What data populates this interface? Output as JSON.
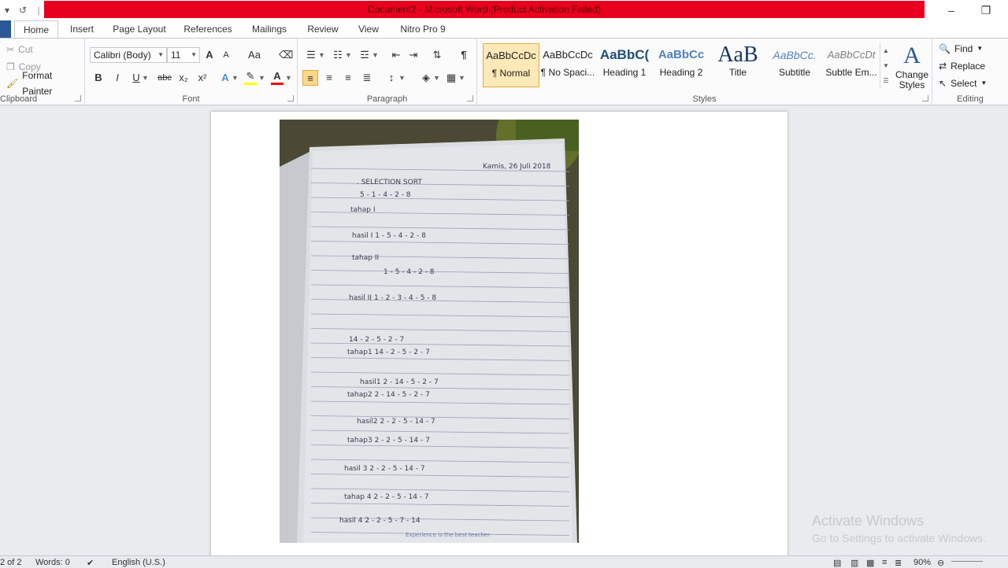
{
  "window": {
    "title": "Document2 - Microsoft Word (Product Activation Failed)",
    "minimize_glyph": "–",
    "restore_glyph": "❐"
  },
  "qat": {
    "save_icon": "save-icon",
    "undo_icon": "undo-icon",
    "redo_icon": "redo-icon",
    "customize_icon": "customize-icon"
  },
  "tabs": [
    "Home",
    "Insert",
    "Page Layout",
    "References",
    "Mailings",
    "Review",
    "View",
    "Nitro Pro 9"
  ],
  "clipboard": {
    "cut": "Cut",
    "copy": "Copy",
    "format_painter": "Format Painter",
    "label": "Clipboard"
  },
  "font": {
    "name": "Calibri (Body)",
    "size": "11",
    "label": "Font",
    "buttons": {
      "bold": "B",
      "italic": "I",
      "underline": "U",
      "strike": "abc",
      "subscript": "x₂",
      "superscript": "x²",
      "grow": "A",
      "shrink": "A",
      "case": "Aa"
    }
  },
  "paragraph": {
    "label": "Paragraph",
    "pilcrow": "¶"
  },
  "styles": {
    "label": "Styles",
    "items": [
      {
        "sample": "AaBbCcDc",
        "name": "¶ Normal"
      },
      {
        "sample": "AaBbCcDc",
        "name": "¶ No Spaci..."
      },
      {
        "sample": "AaBbC(",
        "name": "Heading 1"
      },
      {
        "sample": "AaBbCc",
        "name": "Heading 2"
      },
      {
        "sample": "AaB",
        "name": "Title"
      },
      {
        "sample": "AaBbCc.",
        "name": "Subtitle"
      },
      {
        "sample": "AaBbCcDt",
        "name": "Subtle Em..."
      }
    ],
    "change_styles": "Change Styles"
  },
  "editing": {
    "label": "Editing",
    "find": "Find",
    "replace": "Replace",
    "select": "Select"
  },
  "document": {
    "photo_lines": [
      "Kamis, 26 Juli 2018",
      ". SELECTION SORT",
      "5 - 1 - 4 - 2 - 8",
      "tahap I",
      "hasil I  1 - 5 - 4 - 2 - 8",
      "tahap II",
      "1 - 5 - 4 - 2 - 8",
      "hasil II  1 - 2 - 3 - 4 - 5 - 8",
      "14 - 2 - 5 - 2 - 7",
      "tahap1  14 - 2 - 5 - 2 - 7",
      "hasil1  2 - 14 - 5 - 2 - 7",
      "tahap2  2 - 14 - 5 - 2 - 7",
      "hasil2  2 - 2 - 5 - 14 - 7",
      "tahap3  2 - 2 - 5 - 14 - 7",
      "hasil 3  2 - 2 - 5 - 14 - 7",
      "tahap 4  2 - 2 - 5 - 14 - 7",
      "hasil 4  2 - 2 - 5 - 7 - 14",
      "Experience is the best teacher"
    ]
  },
  "watermark": {
    "line1": "Activate Windows",
    "line2": "Go to Settings to activate Windows."
  },
  "status": {
    "page": "2 of 2",
    "words": "Words: 0",
    "language": "English (U.S.)",
    "zoom": "90%"
  },
  "colors": {
    "titlebar_red": "#e8001e",
    "highlight": "#ffff00",
    "font_color": "#ff0000",
    "accent": "#2b5797"
  }
}
